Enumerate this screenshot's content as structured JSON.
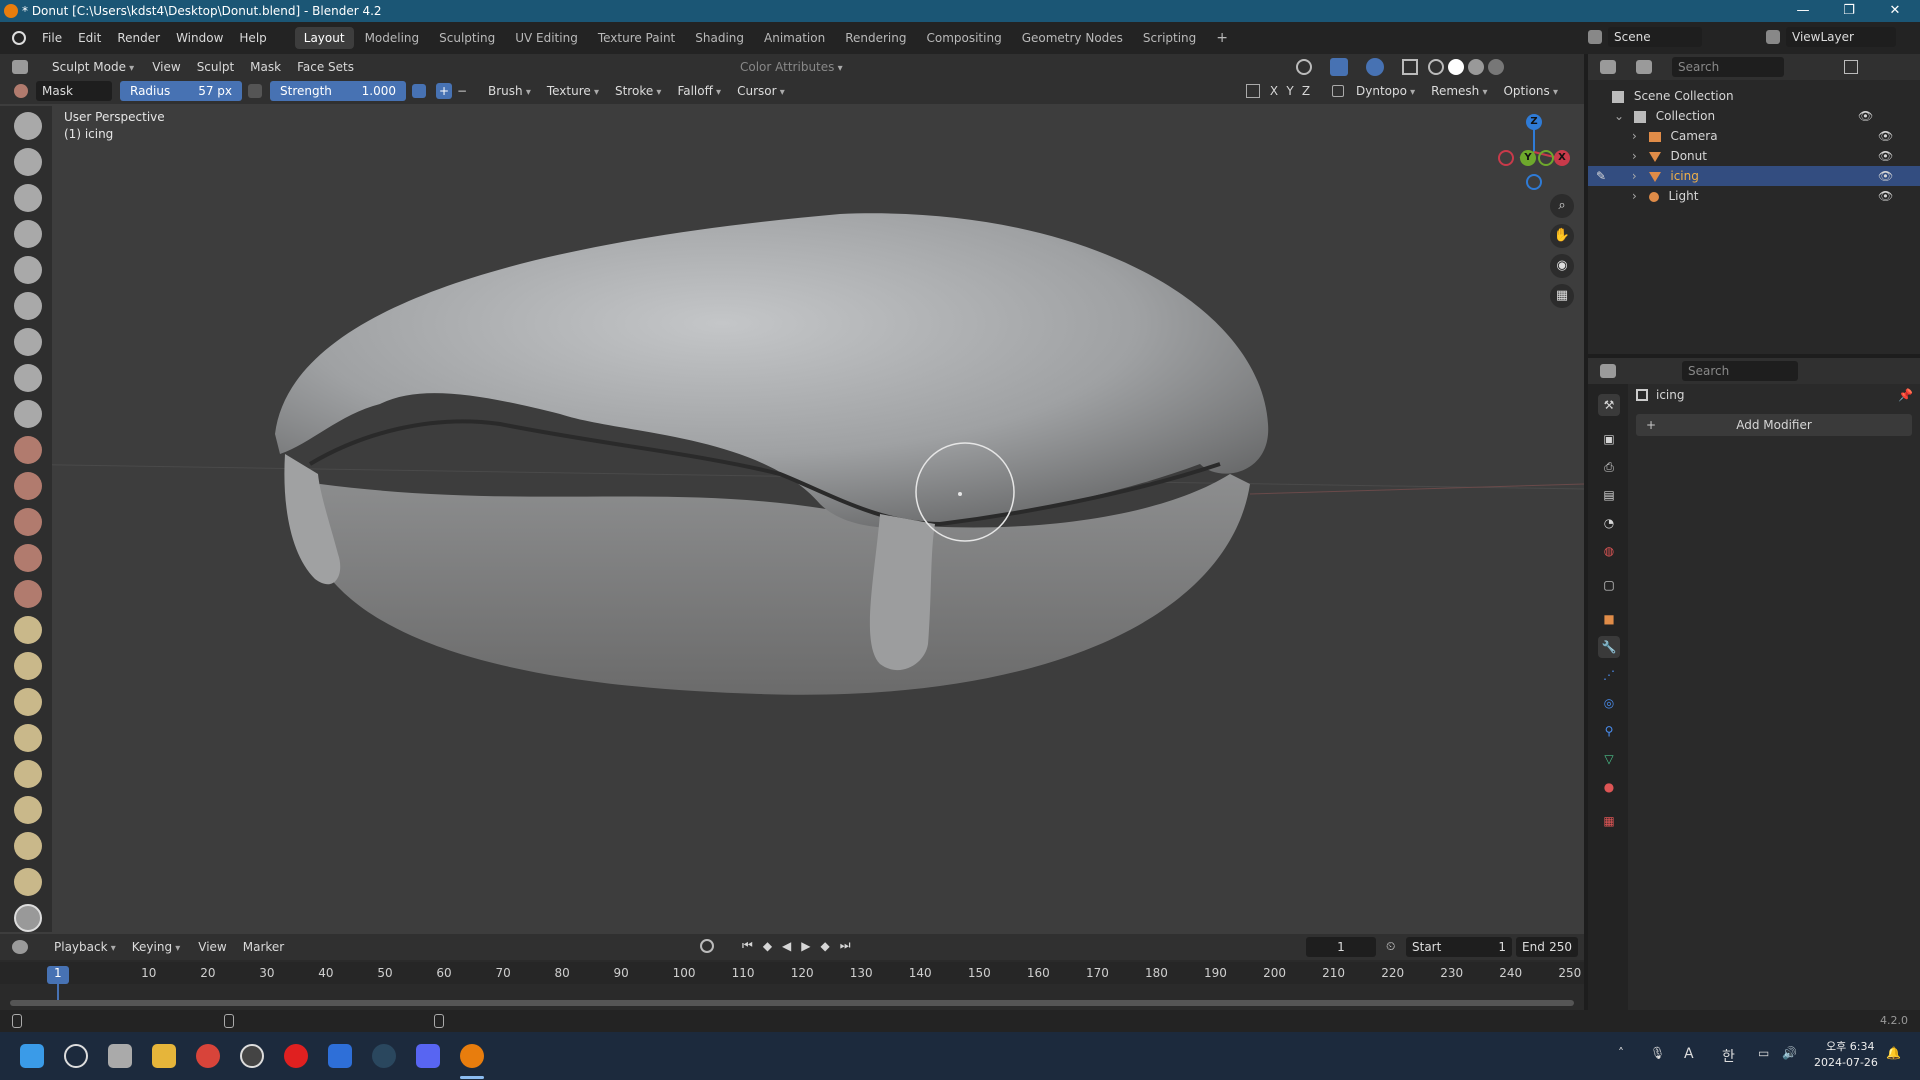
{
  "window": {
    "title": "* Donut [C:\\Users\\kdst4\\Desktop\\Donut.blend] - Blender 4.2",
    "minimize": "—",
    "maximize": "❐",
    "close": "✕"
  },
  "menu": {
    "items": [
      "File",
      "Edit",
      "Render",
      "Window",
      "Help"
    ],
    "workspaces": [
      "Layout",
      "Modeling",
      "Sculpting",
      "UV Editing",
      "Texture Paint",
      "Shading",
      "Animation",
      "Rendering",
      "Compositing",
      "Geometry Nodes",
      "Scripting"
    ],
    "active_workspace": "Layout",
    "add_tab": "+",
    "scene_label": "Scene",
    "viewlayer_label": "ViewLayer"
  },
  "viewport_header": {
    "mode": "Sculpt Mode",
    "menus": [
      "View",
      "Sculpt",
      "Mask",
      "Face Sets"
    ],
    "color_attributes": "Color Attributes"
  },
  "tool_header": {
    "brush_name": "Mask",
    "radius_label": "Radius",
    "radius_value": "57 px",
    "strength_label": "Strength",
    "strength_value": "1.000",
    "plus": "+",
    "minus": "−",
    "menus": [
      "Brush",
      "Texture",
      "Stroke",
      "Falloff",
      "Cursor"
    ],
    "axes": [
      "X",
      "Y",
      "Z"
    ],
    "dyntopo": "Dyntopo",
    "remesh": "Remesh",
    "options": "Options"
  },
  "viewport": {
    "perspective": "User Perspective",
    "object": "(1) icing",
    "gizmo": {
      "z": "Z",
      "y": "Y",
      "x": "X"
    },
    "colors": {
      "background": "#3d3d3d",
      "x_axis": "#c83a4a",
      "y_axis": "#6ea82c",
      "z_axis": "#2f7bd6"
    }
  },
  "outliner": {
    "search_placeholder": "Search",
    "scene_collection": "Scene Collection",
    "collection": "Collection",
    "objects": [
      {
        "name": "Camera",
        "icon": "camera-icon",
        "selected": false
      },
      {
        "name": "Donut",
        "icon": "mesh-icon",
        "selected": false
      },
      {
        "name": "icing",
        "icon": "mesh-icon",
        "selected": true
      },
      {
        "name": "Light",
        "icon": "light-icon",
        "selected": false
      }
    ]
  },
  "properties": {
    "search_placeholder": "Search",
    "object_name": "icing",
    "add_modifier": "Add Modifier",
    "tabs": [
      "tool-icon",
      "render-icon",
      "output-icon",
      "view-layer-icon",
      "scene-icon",
      "world-icon",
      "collection-icon",
      "object-icon",
      "modifier-icon",
      "particles-icon",
      "physics-icon",
      "constraints-icon",
      "data-icon",
      "material-icon",
      "texture-icon"
    ]
  },
  "timeline": {
    "menus": [
      "Playback",
      "Keying",
      "View",
      "Marker"
    ],
    "current_frame": "1",
    "start_label": "Start",
    "start_value": "1",
    "end_label": "End",
    "end_value": "250",
    "ticks": [
      "1",
      "10",
      "20",
      "30",
      "40",
      "50",
      "60",
      "70",
      "80",
      "90",
      "100",
      "110",
      "120",
      "130",
      "140",
      "150",
      "160",
      "170",
      "180",
      "190",
      "200",
      "210",
      "220",
      "230",
      "240",
      "250"
    ]
  },
  "statusbar": {
    "version": "4.2.0"
  },
  "taskbar": {
    "time": "오후 6:34",
    "date": "2024-07-26",
    "ime": "A",
    "lang": "한"
  }
}
